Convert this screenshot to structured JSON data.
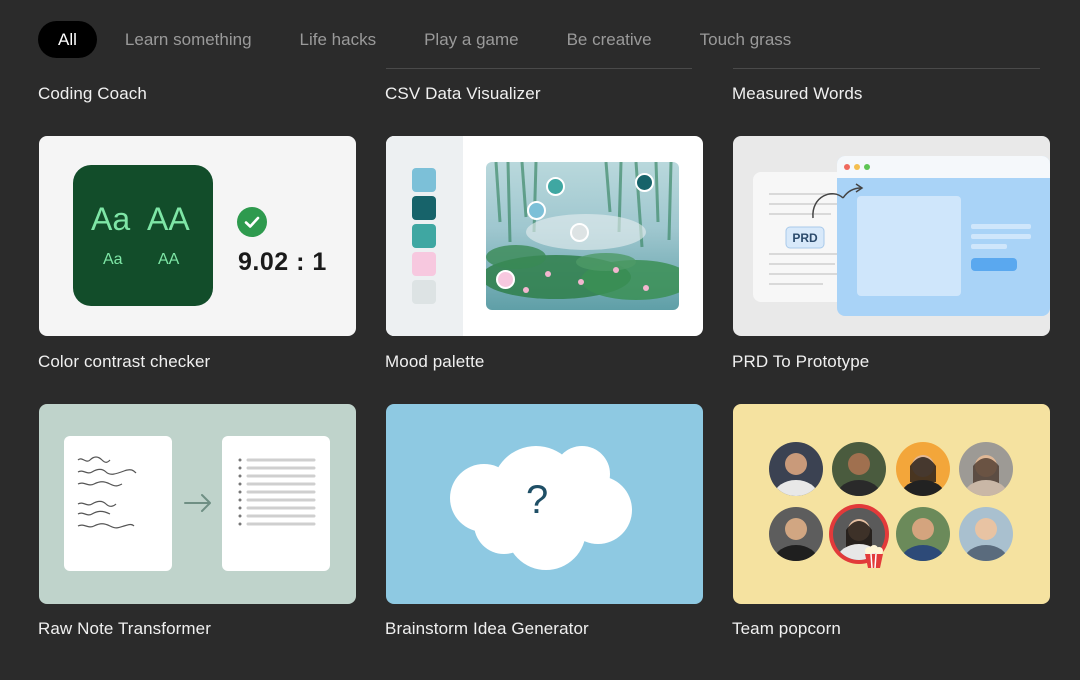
{
  "tabs": [
    {
      "label": "All",
      "active": true
    },
    {
      "label": "Learn something",
      "active": false
    },
    {
      "label": "Life hacks",
      "active": false
    },
    {
      "label": "Play a game",
      "active": false
    },
    {
      "label": "Be creative",
      "active": false
    },
    {
      "label": "Touch grass",
      "active": false
    }
  ],
  "top_titles": [
    "Coding Coach",
    "CSV Data Visualizer",
    "Measured Words"
  ],
  "cards": [
    {
      "title": "Color contrast checker",
      "preview": {
        "big_a": "Aa",
        "big_b": "AA",
        "small_a": "Aa",
        "small_b": "AA",
        "ratio": "9.02 : 1",
        "swatch_color": "#124d2a",
        "text_color": "#7ee6a6",
        "icon": "check-circle-icon"
      }
    },
    {
      "title": "Mood palette",
      "preview": {
        "palette": [
          "#7cc0d8",
          "#17636a",
          "#3fa7a2",
          "#f7c8df",
          "#dde3e4"
        ]
      }
    },
    {
      "title": "PRD To Prototype",
      "preview": {
        "doc_label": "PRD",
        "icon": "arrow-icon"
      }
    },
    {
      "title": "Raw Note Transformer",
      "preview": {
        "icon": "arrow-right-icon"
      }
    },
    {
      "title": "Brainstorm Idea Generator",
      "preview": {
        "symbol": "?",
        "icon": "cloud-icon"
      }
    },
    {
      "title": "Team popcorn",
      "preview": {
        "avatar_count": 8,
        "icon": "popcorn-icon"
      }
    }
  ]
}
